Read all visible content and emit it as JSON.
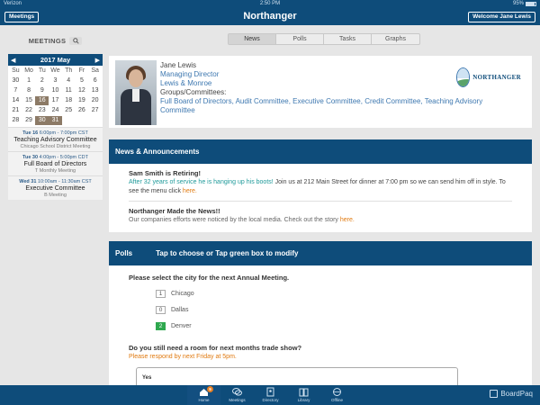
{
  "status_bar": {
    "carrier": "Verizon",
    "time": "2:50 PM",
    "battery": "95%"
  },
  "topbar": {
    "meetings_button": "Meetings",
    "title": "Northanger",
    "welcome_button": "Welcome Jane Lewis"
  },
  "sidebar": {
    "heading": "MEETINGS",
    "calendar": {
      "month": "2017 May",
      "weekdays": [
        "Su",
        "Mo",
        "Tu",
        "We",
        "Th",
        "Fr",
        "Sa"
      ],
      "days": [
        "30",
        "1",
        "2",
        "3",
        "4",
        "5",
        "6",
        "7",
        "8",
        "9",
        "10",
        "11",
        "12",
        "13",
        "14",
        "15",
        "16",
        "17",
        "18",
        "19",
        "20",
        "21",
        "22",
        "23",
        "24",
        "25",
        "26",
        "27",
        "28",
        "29",
        "30",
        "31"
      ],
      "meeting_days": [
        "16",
        "30",
        "31"
      ]
    },
    "events": [
      {
        "day": "Tue 16",
        "time": "6:00pm - 7:00pm CST",
        "name": "Teaching Advisory Committee",
        "sub": "Chicago School District Meeting"
      },
      {
        "day": "Tue 30",
        "time": "4:00pm - 5:00pm CDT",
        "name": "Full Board of Directors",
        "sub": "T Monthly Meeting"
      },
      {
        "day": "Wed 31",
        "time": "10:00am - 11:30am CST",
        "name": "Executive Committee",
        "sub": "B Meeting"
      }
    ]
  },
  "tabs": [
    "News",
    "Polls",
    "Tasks",
    "Graphs"
  ],
  "profile": {
    "name": "Jane Lewis",
    "title": "Managing Director",
    "company": "Lewis & Monroe",
    "groups_label": "Groups/Committees:",
    "groups": "Full Board of Directors, Audit Committee, Executive Committee, Credit Committee, Teaching Advisory Committee",
    "logo_text": "NORTHANGER"
  },
  "news": {
    "heading": "News & Announcements",
    "items": [
      {
        "title": "Sam Smith is Retiring!",
        "highlight": "After 32 years of service he is hanging up his boots!",
        "body": " Join us at 212 Main Street for dinner at 7:00 pm so we can send him off in style. To see the menu click ",
        "link": "here."
      },
      {
        "title": "Northanger Made the News!!",
        "body": "Our companies efforts were noticed by the local media. Check out the story ",
        "link": "here."
      }
    ]
  },
  "polls": {
    "heading": "Polls",
    "instruction": "Tap to choose or Tap green box to modify",
    "question1": "Please select the city for the next Annual Meeting.",
    "options": [
      {
        "count": "1",
        "label": "Chicago",
        "selected": false
      },
      {
        "count": "0",
        "label": "Dallas",
        "selected": false
      },
      {
        "count": "2",
        "label": "Denver",
        "selected": true
      }
    ],
    "question2": "Do you still need a room for next months trade show?",
    "note": "Please respond by next Friday at 5pm.",
    "answer_option": "Yes"
  },
  "bottom_nav": {
    "items": [
      {
        "label": "Home",
        "icon": "home-icon",
        "badge": "9"
      },
      {
        "label": "Meetings",
        "icon": "meetings-icon"
      },
      {
        "label": "Directory",
        "icon": "directory-icon"
      },
      {
        "label": "Library",
        "icon": "library-icon"
      },
      {
        "label": "Offline",
        "icon": "offline-icon"
      }
    ],
    "brand": "BoardPaq"
  },
  "colors": {
    "primary": "#0e4c7a",
    "accent_orange": "#e07a10",
    "accent_teal": "#1f9a9a",
    "poll_selected": "#2fa84f",
    "meeting_day": "#8c7a66"
  }
}
